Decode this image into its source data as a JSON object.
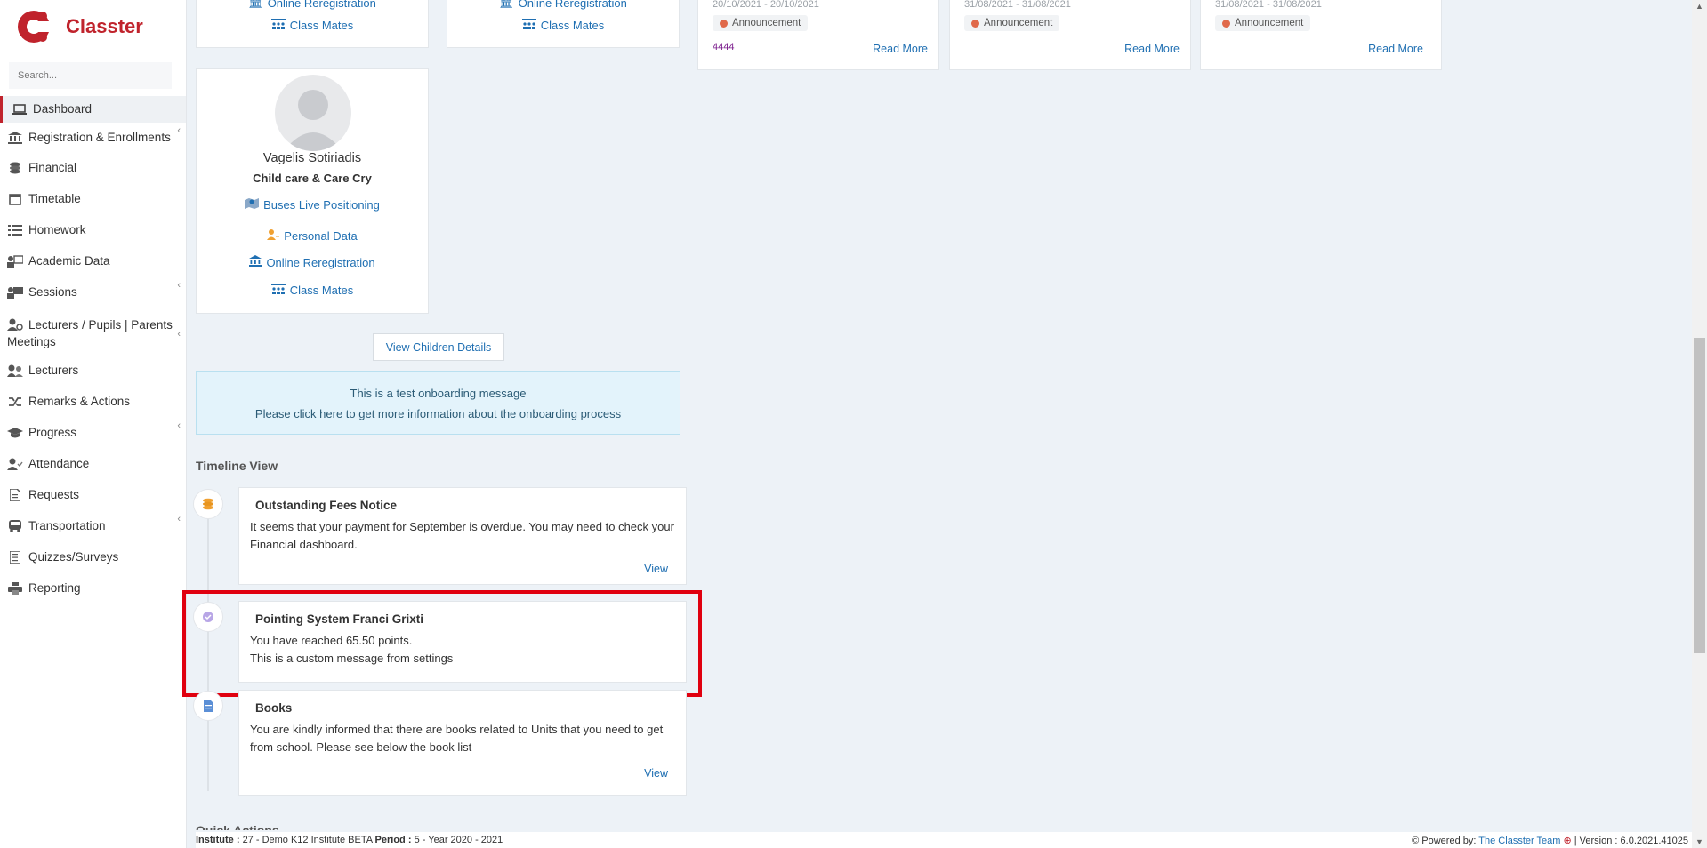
{
  "app": {
    "name": "Classter"
  },
  "search": {
    "placeholder": "Search..."
  },
  "sidebar": {
    "items": [
      {
        "label": "Dashboard",
        "active": true,
        "has_submenu": false
      },
      {
        "label": "Registration & Enrollments",
        "has_submenu": true
      },
      {
        "label": "Financial",
        "has_submenu": false
      },
      {
        "label": "Timetable",
        "has_submenu": false
      },
      {
        "label": "Homework",
        "has_submenu": false
      },
      {
        "label": "Academic Data",
        "has_submenu": false
      },
      {
        "label": "Sessions",
        "has_submenu": true
      },
      {
        "label": "Lecturers / Pupils | Parents Meetings",
        "has_submenu": true
      },
      {
        "label": "Lecturers",
        "has_submenu": false
      },
      {
        "label": "Remarks & Actions",
        "has_submenu": false
      },
      {
        "label": "Progress",
        "has_submenu": true
      },
      {
        "label": "Attendance",
        "has_submenu": false
      },
      {
        "label": "Requests",
        "has_submenu": false
      },
      {
        "label": "Transportation",
        "has_submenu": true
      },
      {
        "label": "Quizzes/Surveys",
        "has_submenu": false
      },
      {
        "label": "Reporting",
        "has_submenu": false
      }
    ]
  },
  "children": {
    "top_cards": [
      {
        "partial_link": "Online Reregistration",
        "class_mates": "Class Mates"
      },
      {
        "partial_link": "Online Reregistration",
        "class_mates": "Class Mates"
      }
    ],
    "child": {
      "name": "Vagelis Sotiriadis",
      "class": "Child care & Care Cry",
      "links": [
        "Buses Live Positioning",
        "Personal Data",
        "Online Reregistration",
        "Class Mates"
      ]
    },
    "view_details_label": "View Children Details"
  },
  "announcements": [
    {
      "date": "20/10/2021 - 20/10/2021",
      "badge": "Announcement",
      "extra": "4444",
      "read_more": "Read More"
    },
    {
      "date": "31/08/2021 - 31/08/2021",
      "badge": "Announcement",
      "extra": "",
      "read_more": "Read More"
    },
    {
      "date": "31/08/2021 - 31/08/2021",
      "badge": "Announcement",
      "extra": "",
      "read_more": "Read More"
    }
  ],
  "onboarding": {
    "line1": "This is a test onboarding message",
    "line2": "Please click here to get more information about the onboarding process"
  },
  "timeline": {
    "heading": "Timeline View",
    "entries": [
      {
        "title": "Outstanding Fees Notice",
        "text": "It seems that your payment for September is overdue. You may need to check your Financial dashboard.",
        "view": "View",
        "icon": "coins-icon"
      },
      {
        "title": "Pointing System Franci Grixti",
        "line1": "You have reached 65.50 points.",
        "line2": "This is a custom message from settings",
        "icon": "check-circle-icon"
      },
      {
        "title": "Books",
        "text": "You are kindly informed that there are books related to Units that you need to get from school. Please see below the book list",
        "view": "View",
        "icon": "document-icon"
      }
    ],
    "next_heading_partial": "Quick Actions"
  },
  "footer": {
    "institute_label": "Institute :",
    "institute_value": "27 - Demo K12 Institute BETA",
    "period_label": "Period :",
    "period_value": "5 - Year 2020 - 2021",
    "powered_label": "Powered by:",
    "powered_value": "The Classter Team",
    "version": "| Version : 6.0.2021.41025"
  },
  "colors": {
    "brand": "#c0232c",
    "link": "#1f6fb2",
    "highlight": "#e0000f"
  }
}
